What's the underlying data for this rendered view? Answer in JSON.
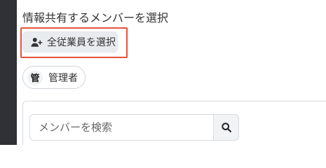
{
  "header": {
    "title": "情報共有するメンバーを選択"
  },
  "actions": {
    "select_all_label": "全従業員を選択",
    "select_all_icon": "user-plus-icon",
    "highlight_color": "#e5533b"
  },
  "selected_members": [
    {
      "badge": "管",
      "label": "管理者"
    }
  ],
  "search": {
    "placeholder": "メンバーを検索",
    "value": "",
    "button_icon": "search-icon"
  }
}
